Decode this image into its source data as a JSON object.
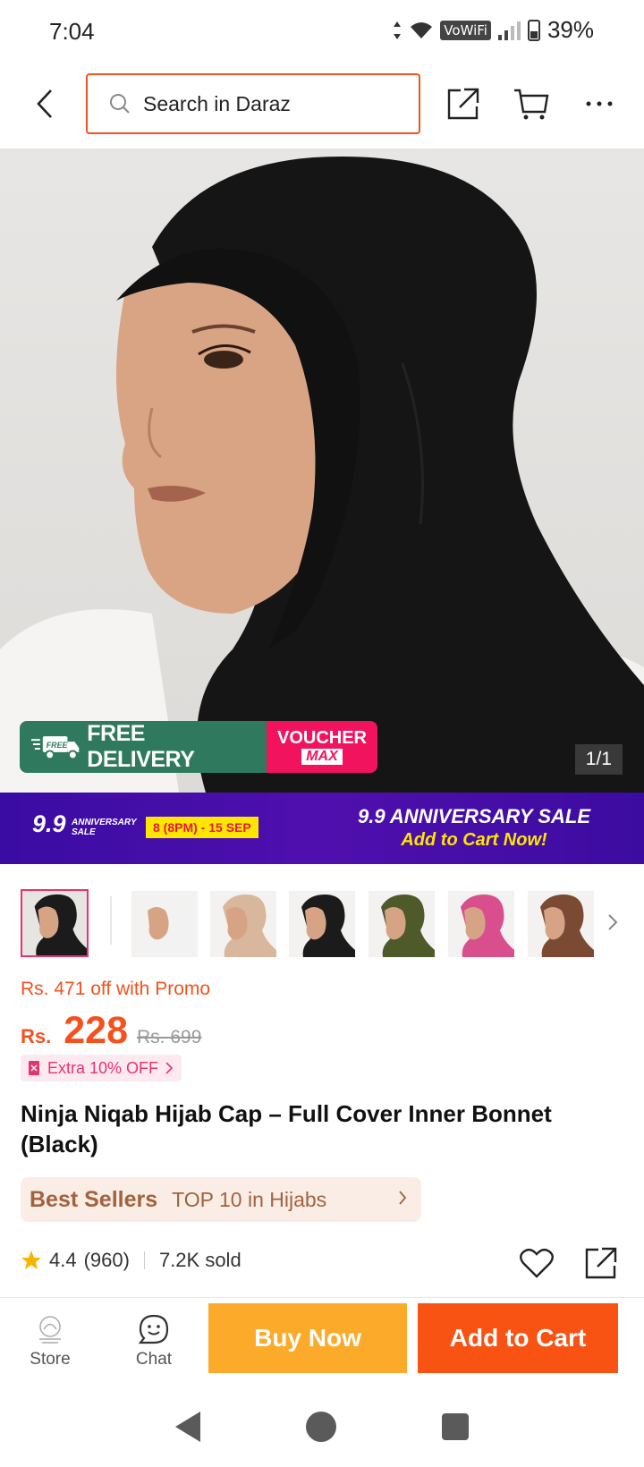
{
  "status_bar": {
    "time": "7:04",
    "network_badge": "VoWiFi",
    "battery": "39%"
  },
  "header": {
    "search_placeholder": "Search in Daraz",
    "icons": [
      "back-arrow-icon",
      "search-icon",
      "share-icon",
      "cart-icon",
      "more-icon"
    ]
  },
  "hero": {
    "badge_free": "FREE",
    "badge_delivery": "FREE DELIVERY",
    "badge_voucher": "VOUCHER",
    "badge_max": "MAX",
    "counter": "1/1"
  },
  "sale_banner": {
    "logo_num": "9.9",
    "logo_text": "ANNIVERSARY SALE",
    "dates": "8 (8PM) - 15 SEP",
    "title": "9.9 ANNIVERSARY SALE",
    "subtitle": "Add to Cart Now!"
  },
  "thumbnails": [
    {
      "color": "#1b1b1b",
      "selected": true
    },
    {
      "color": "#f2f2f2",
      "selected": false
    },
    {
      "color": "#d8b79c",
      "selected": false
    },
    {
      "color": "#1b1b1b",
      "selected": false
    },
    {
      "color": "#4e5a2a",
      "selected": false
    },
    {
      "color": "#d94f8d",
      "selected": false
    },
    {
      "color": "#7a4a32",
      "selected": false
    }
  ],
  "price": {
    "promo_text": "Rs. 471 off with Promo",
    "currency": "Rs.",
    "value": "228",
    "original": "Rs. 699",
    "extra": "Extra 10% OFF"
  },
  "product": {
    "title": "Ninja Niqab Hijab Cap – Full Cover Inner Bonnet (Black)"
  },
  "best_sellers": {
    "label": "Best Sellers",
    "rank": "TOP 10 in Hijabs"
  },
  "rating": {
    "score": "4.4",
    "count": "(960)",
    "sold": "7.2K sold"
  },
  "bottom_bar": {
    "store": "Store",
    "chat": "Chat",
    "buy_now": "Buy Now",
    "add_to_cart": "Add to Cart"
  },
  "colors": {
    "accent": "#f85313",
    "buy_now": "#fbab29",
    "sale_purple": "#3a0ca3",
    "free_delivery_green": "#2f7a5e",
    "voucher_pink": "#f2135f"
  }
}
